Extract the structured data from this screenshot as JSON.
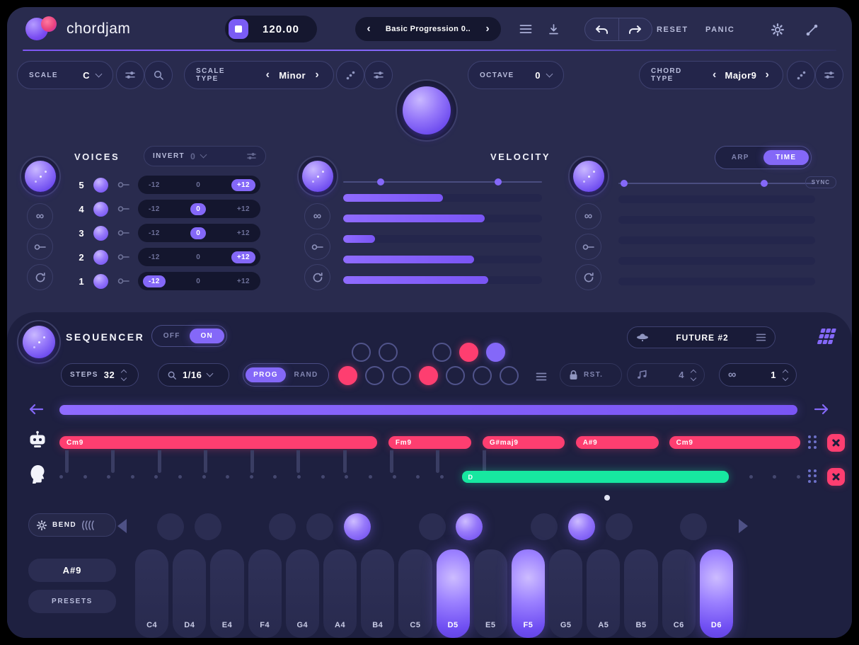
{
  "header": {
    "logo": "chordjam",
    "bpm": "120.00",
    "preset": "Basic Progression 0..",
    "reset": "RESET",
    "panic": "PANIC"
  },
  "controls": {
    "scale_label": "SCALE",
    "scale_value": "C",
    "scale_type_label": "SCALE TYPE",
    "scale_type_value": "Minor",
    "octave_label": "OCTAVE",
    "octave_value": "0",
    "chord_type_label": "CHORD TYPE",
    "chord_type_value": "Major9"
  },
  "voices": {
    "title": "VOICES",
    "invert_label": "INVERT",
    "invert_value": "0",
    "slider_min": "-12",
    "slider_mid": "0",
    "slider_max": "+12",
    "rows": [
      {
        "num": "5",
        "selected": "max"
      },
      {
        "num": "4",
        "selected": "mid"
      },
      {
        "num": "3",
        "selected": "mid"
      },
      {
        "num": "2",
        "selected": "max"
      },
      {
        "num": "1",
        "selected": "min"
      }
    ]
  },
  "velocity": {
    "title": "VELOCITY",
    "range": [
      19,
      78
    ],
    "bars": [
      50,
      71,
      16,
      66,
      73
    ]
  },
  "time_panel": {
    "arp": "ARP",
    "time": "TIME",
    "selected": "TIME",
    "sync": "SYNC",
    "range": [
      3,
      74
    ],
    "bars": [
      0,
      0,
      0,
      0,
      0
    ]
  },
  "sequencer": {
    "title": "SEQUENCER",
    "off": "OFF",
    "on": "ON",
    "power": "ON",
    "steps_label": "STEPS",
    "steps_value": "32",
    "quant_value": "1/16",
    "prog": "PROG",
    "rand": "RAND",
    "mode": "PROG",
    "rst": "RST.",
    "bars_value": "4",
    "loop_value": "1",
    "preset": "FUTURE #2",
    "steps_top": [
      "empty",
      "empty",
      "none",
      "empty",
      "pink",
      "purple"
    ],
    "steps_bottom": [
      "pink",
      "empty",
      "empty",
      "pink",
      "empty",
      "empty",
      "empty"
    ],
    "dot_count": 32,
    "connectors": [
      0.8,
      7.0,
      13.3,
      19.5,
      25.8,
      32.0,
      38.3,
      44.6,
      50.8,
      57.1
    ],
    "chords": [
      {
        "label": "Cm9",
        "start": 0,
        "width": 42.9
      },
      {
        "label": "Fm9",
        "start": 44.4,
        "width": 11.2
      },
      {
        "label": "G#maj9",
        "start": 57.1,
        "width": 11.1
      },
      {
        "label": "A#9",
        "start": 69.7,
        "width": 11.2
      },
      {
        "label": "Cm9",
        "start": 82.3,
        "width": 17.7
      }
    ],
    "note_bar": {
      "label": "D",
      "start": 54.3,
      "width": 36.1
    },
    "colors": {
      "chord": "#fe3e70",
      "note": "#17e8a0",
      "accent": "#8468f8"
    }
  },
  "keyboard": {
    "bend": "BEND",
    "chord": "A#9",
    "presets": "PRESETS",
    "keys": [
      {
        "label": "C4",
        "active": false
      },
      {
        "label": "D4",
        "active": false
      },
      {
        "label": "E4",
        "active": false
      },
      {
        "label": "F4",
        "active": false
      },
      {
        "label": "G4",
        "active": false
      },
      {
        "label": "A4",
        "active": false
      },
      {
        "label": "B4",
        "active": false
      },
      {
        "label": "C5",
        "active": false
      },
      {
        "label": "D5",
        "active": true
      },
      {
        "label": "E5",
        "active": false
      },
      {
        "label": "F5",
        "active": true
      },
      {
        "label": "G5",
        "active": false
      },
      {
        "label": "A5",
        "active": false
      },
      {
        "label": "B5",
        "active": false
      },
      {
        "label": "C6",
        "active": false
      },
      {
        "label": "D6",
        "active": true
      }
    ],
    "pads": [
      {
        "note": "C#4",
        "pos": 1,
        "active": false
      },
      {
        "note": "D#4",
        "pos": 2,
        "active": false
      },
      {
        "note": "F#4",
        "pos": 4,
        "active": false
      },
      {
        "note": "G#4",
        "pos": 5,
        "active": false
      },
      {
        "note": "A#4",
        "pos": 6,
        "active": true
      },
      {
        "note": "C#5",
        "pos": 8,
        "active": false
      },
      {
        "note": "D#5",
        "pos": 9,
        "active": true
      },
      {
        "note": "F#5",
        "pos": 11,
        "active": false
      },
      {
        "note": "G#5",
        "pos": 12,
        "active": true
      },
      {
        "note": "A#5",
        "pos": 13,
        "active": false
      },
      {
        "note": "C#6",
        "pos": 15,
        "active": false
      }
    ]
  }
}
